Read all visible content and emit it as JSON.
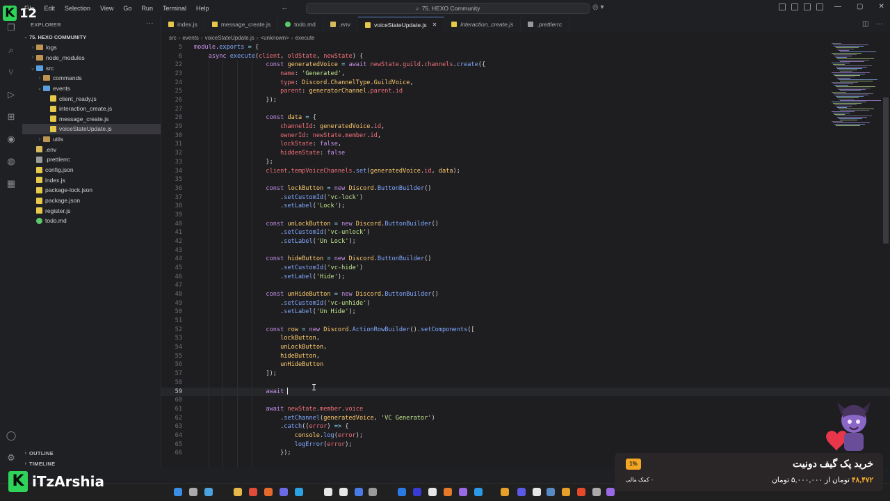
{
  "menu": [
    "File",
    "Edit",
    "Selection",
    "View",
    "Go",
    "Run",
    "Terminal",
    "Help"
  ],
  "command_center": "75. HEXO Community",
  "explorer": {
    "header": "EXPLORER",
    "root": "75. HEXO COMMUNITY",
    "items": [
      {
        "label": "logs",
        "type": "folder",
        "depth": 1,
        "open": false
      },
      {
        "label": "node_modules",
        "type": "folder",
        "depth": 1,
        "open": false
      },
      {
        "label": "src",
        "type": "folder",
        "depth": 1,
        "open": true
      },
      {
        "label": "commands",
        "type": "folder",
        "depth": 2,
        "open": false
      },
      {
        "label": "events",
        "type": "folder",
        "depth": 2,
        "open": true
      },
      {
        "label": "client_ready.js",
        "type": "js",
        "depth": 3
      },
      {
        "label": "interaction_create.js",
        "type": "js",
        "depth": 3
      },
      {
        "label": "message_create.js",
        "type": "js",
        "depth": 3
      },
      {
        "label": "voiceStateUpdate.js",
        "type": "js",
        "depth": 3,
        "selected": true
      },
      {
        "label": "utils",
        "type": "folder",
        "depth": 2,
        "open": false
      },
      {
        "label": ".env",
        "type": "env",
        "depth": 1
      },
      {
        "label": ".prettierrc",
        "type": "config",
        "depth": 1
      },
      {
        "label": "config.json",
        "type": "json",
        "depth": 1
      },
      {
        "label": "index.js",
        "type": "js",
        "depth": 1
      },
      {
        "label": "package-lock.json",
        "type": "json",
        "depth": 1
      },
      {
        "label": "package.json",
        "type": "json",
        "depth": 1
      },
      {
        "label": "register.js",
        "type": "js",
        "depth": 1
      },
      {
        "label": "todo.md",
        "type": "md",
        "depth": 1
      }
    ],
    "outline": "OUTLINE",
    "timeline": "TIMELINE"
  },
  "tabs": [
    {
      "label": "index.js",
      "type": "js"
    },
    {
      "label": "message_create.js",
      "type": "js"
    },
    {
      "label": "todo.md",
      "type": "md"
    },
    {
      "label": ".env",
      "type": "env"
    },
    {
      "label": "voiceStateUpdate.js",
      "type": "js",
      "active": true
    },
    {
      "label": "interaction_create.js",
      "type": "js"
    },
    {
      "label": ".prettierrc",
      "type": "config"
    }
  ],
  "breadcrumb": [
    "src",
    "events",
    "voiceStateUpdate.js",
    "<unknown>",
    "execute"
  ],
  "code_lines": [
    {
      "n": "5",
      "indent": 0,
      "code": [
        [
          "k",
          "module"
        ],
        [
          "t",
          "."
        ],
        [
          "f",
          "exports"
        ],
        [
          "t",
          " "
        ],
        [
          "o",
          "="
        ],
        [
          "t",
          " {"
        ]
      ]
    },
    {
      "n": "6",
      "indent": 1,
      "code": [
        [
          "k",
          "async "
        ],
        [
          "f",
          "execute"
        ],
        [
          "t",
          "("
        ],
        [
          "v",
          "client"
        ],
        [
          "t",
          ", "
        ],
        [
          "v",
          "oldState"
        ],
        [
          "t",
          ", "
        ],
        [
          "v",
          "newState"
        ],
        [
          "t",
          ") {"
        ]
      ]
    },
    {
      "n": "22",
      "indent": 5,
      "code": [
        [
          "k",
          "const "
        ],
        [
          "c",
          "generatedVoice"
        ],
        [
          "t",
          " "
        ],
        [
          "o",
          "="
        ],
        [
          "t",
          " "
        ],
        [
          "k",
          "await "
        ],
        [
          "v",
          "newState"
        ],
        [
          "t",
          "."
        ],
        [
          "v",
          "guild"
        ],
        [
          "t",
          "."
        ],
        [
          "v",
          "channels"
        ],
        [
          "t",
          "."
        ],
        [
          "f",
          "create"
        ],
        [
          "t",
          "({"
        ]
      ]
    },
    {
      "n": "23",
      "indent": 6,
      "code": [
        [
          "v",
          "name"
        ],
        [
          "t",
          ": "
        ],
        [
          "s",
          "'Generated'"
        ],
        [
          "t",
          ","
        ]
      ]
    },
    {
      "n": "24",
      "indent": 6,
      "code": [
        [
          "v",
          "type"
        ],
        [
          "t",
          ": "
        ],
        [
          "c",
          "Discord"
        ],
        [
          "t",
          "."
        ],
        [
          "c",
          "ChannelType"
        ],
        [
          "t",
          "."
        ],
        [
          "c",
          "GuildVoice"
        ],
        [
          "t",
          ","
        ]
      ]
    },
    {
      "n": "25",
      "indent": 6,
      "code": [
        [
          "v",
          "parent"
        ],
        [
          "t",
          ": "
        ],
        [
          "c",
          "generatorChannel"
        ],
        [
          "t",
          "."
        ],
        [
          "v",
          "parent"
        ],
        [
          "t",
          "."
        ],
        [
          "v",
          "id"
        ]
      ]
    },
    {
      "n": "26",
      "indent": 5,
      "code": [
        [
          "t",
          "});"
        ]
      ]
    },
    {
      "n": "27",
      "indent": 5,
      "code": []
    },
    {
      "n": "28",
      "indent": 5,
      "code": [
        [
          "k",
          "const "
        ],
        [
          "c",
          "data"
        ],
        [
          "t",
          " "
        ],
        [
          "o",
          "="
        ],
        [
          "t",
          " {"
        ]
      ]
    },
    {
      "n": "29",
      "indent": 6,
      "code": [
        [
          "v",
          "channelId"
        ],
        [
          "t",
          ": "
        ],
        [
          "c",
          "generatedVoice"
        ],
        [
          "t",
          "."
        ],
        [
          "v",
          "id"
        ],
        [
          "t",
          ","
        ]
      ]
    },
    {
      "n": "30",
      "indent": 6,
      "code": [
        [
          "v",
          "ownerId"
        ],
        [
          "t",
          ": "
        ],
        [
          "v",
          "newState"
        ],
        [
          "t",
          "."
        ],
        [
          "v",
          "member"
        ],
        [
          "t",
          "."
        ],
        [
          "v",
          "id"
        ],
        [
          "t",
          ","
        ]
      ]
    },
    {
      "n": "31",
      "indent": 6,
      "code": [
        [
          "v",
          "lockState"
        ],
        [
          "t",
          ": "
        ],
        [
          "k",
          "false"
        ],
        [
          "t",
          ","
        ]
      ]
    },
    {
      "n": "32",
      "indent": 6,
      "code": [
        [
          "v",
          "hiddenState"
        ],
        [
          "t",
          ": "
        ],
        [
          "k",
          "false"
        ]
      ]
    },
    {
      "n": "33",
      "indent": 5,
      "code": [
        [
          "t",
          "};"
        ]
      ]
    },
    {
      "n": "34",
      "indent": 5,
      "code": [
        [
          "v",
          "client"
        ],
        [
          "t",
          "."
        ],
        [
          "v",
          "tempVoiceChannels"
        ],
        [
          "t",
          "."
        ],
        [
          "f",
          "set"
        ],
        [
          "t",
          "("
        ],
        [
          "c",
          "generatedVoice"
        ],
        [
          "t",
          "."
        ],
        [
          "v",
          "id"
        ],
        [
          "t",
          ", "
        ],
        [
          "c",
          "data"
        ],
        [
          "t",
          ");"
        ]
      ]
    },
    {
      "n": "35",
      "indent": 5,
      "code": []
    },
    {
      "n": "36",
      "indent": 5,
      "code": [
        [
          "k",
          "const "
        ],
        [
          "c",
          "lockButton"
        ],
        [
          "t",
          " "
        ],
        [
          "o",
          "="
        ],
        [
          "t",
          " "
        ],
        [
          "k",
          "new "
        ],
        [
          "c",
          "Discord"
        ],
        [
          "t",
          "."
        ],
        [
          "f",
          "ButtonBuilder"
        ],
        [
          "t",
          "()"
        ]
      ]
    },
    {
      "n": "37",
      "indent": 6,
      "code": [
        [
          "t",
          "."
        ],
        [
          "f",
          "setCustomId"
        ],
        [
          "t",
          "("
        ],
        [
          "s",
          "'vc-lock'"
        ],
        [
          "t",
          ")"
        ]
      ]
    },
    {
      "n": "38",
      "indent": 6,
      "code": [
        [
          "t",
          "."
        ],
        [
          "f",
          "setLabel"
        ],
        [
          "t",
          "("
        ],
        [
          "s",
          "'Lock'"
        ],
        [
          "t",
          ");"
        ]
      ]
    },
    {
      "n": "39",
      "indent": 5,
      "code": []
    },
    {
      "n": "40",
      "indent": 5,
      "code": [
        [
          "k",
          "const "
        ],
        [
          "c",
          "unLockButton"
        ],
        [
          "t",
          " "
        ],
        [
          "o",
          "="
        ],
        [
          "t",
          " "
        ],
        [
          "k",
          "new "
        ],
        [
          "c",
          "Discord"
        ],
        [
          "t",
          "."
        ],
        [
          "f",
          "ButtonBuilder"
        ],
        [
          "t",
          "()"
        ]
      ]
    },
    {
      "n": "41",
      "indent": 6,
      "code": [
        [
          "t",
          "."
        ],
        [
          "f",
          "setCustomId"
        ],
        [
          "t",
          "("
        ],
        [
          "s",
          "'vc-unlock'"
        ],
        [
          "t",
          ")"
        ]
      ]
    },
    {
      "n": "42",
      "indent": 6,
      "code": [
        [
          "t",
          "."
        ],
        [
          "f",
          "setLabel"
        ],
        [
          "t",
          "("
        ],
        [
          "s",
          "'Un Lock'"
        ],
        [
          "t",
          ");"
        ]
      ]
    },
    {
      "n": "43",
      "indent": 5,
      "code": []
    },
    {
      "n": "44",
      "indent": 5,
      "code": [
        [
          "k",
          "const "
        ],
        [
          "c",
          "hideButton"
        ],
        [
          "t",
          " "
        ],
        [
          "o",
          "="
        ],
        [
          "t",
          " "
        ],
        [
          "k",
          "new "
        ],
        [
          "c",
          "Discord"
        ],
        [
          "t",
          "."
        ],
        [
          "f",
          "ButtonBuilder"
        ],
        [
          "t",
          "()"
        ]
      ]
    },
    {
      "n": "45",
      "indent": 6,
      "code": [
        [
          "t",
          "."
        ],
        [
          "f",
          "setCustomId"
        ],
        [
          "t",
          "("
        ],
        [
          "s",
          "'vc-hide'"
        ],
        [
          "t",
          ")"
        ]
      ]
    },
    {
      "n": "46",
      "indent": 6,
      "code": [
        [
          "t",
          "."
        ],
        [
          "f",
          "setLabel"
        ],
        [
          "t",
          "("
        ],
        [
          "s",
          "'Hide'"
        ],
        [
          "t",
          ");"
        ]
      ]
    },
    {
      "n": "47",
      "indent": 5,
      "code": []
    },
    {
      "n": "48",
      "indent": 5,
      "code": [
        [
          "k",
          "const "
        ],
        [
          "c",
          "unHideButton"
        ],
        [
          "t",
          " "
        ],
        [
          "o",
          "="
        ],
        [
          "t",
          " "
        ],
        [
          "k",
          "new "
        ],
        [
          "c",
          "Discord"
        ],
        [
          "t",
          "."
        ],
        [
          "f",
          "ButtonBuilder"
        ],
        [
          "t",
          "()"
        ]
      ]
    },
    {
      "n": "49",
      "indent": 6,
      "code": [
        [
          "t",
          "."
        ],
        [
          "f",
          "setCustomId"
        ],
        [
          "t",
          "("
        ],
        [
          "s",
          "'vc-unhide'"
        ],
        [
          "t",
          ")"
        ]
      ]
    },
    {
      "n": "50",
      "indent": 6,
      "code": [
        [
          "t",
          "."
        ],
        [
          "f",
          "setLabel"
        ],
        [
          "t",
          "("
        ],
        [
          "s",
          "'Un Hide'"
        ],
        [
          "t",
          ");"
        ]
      ]
    },
    {
      "n": "51",
      "indent": 5,
      "code": []
    },
    {
      "n": "52",
      "indent": 5,
      "code": [
        [
          "k",
          "const "
        ],
        [
          "c",
          "row"
        ],
        [
          "t",
          " "
        ],
        [
          "o",
          "="
        ],
        [
          "t",
          " "
        ],
        [
          "k",
          "new "
        ],
        [
          "c",
          "Discord"
        ],
        [
          "t",
          "."
        ],
        [
          "f",
          "ActionRowBuilder"
        ],
        [
          "t",
          "()."
        ],
        [
          "f",
          "setComponents"
        ],
        [
          "t",
          "(["
        ]
      ]
    },
    {
      "n": "53",
      "indent": 6,
      "code": [
        [
          "c",
          "lockButton"
        ],
        [
          "t",
          ","
        ]
      ]
    },
    {
      "n": "54",
      "indent": 6,
      "code": [
        [
          "c",
          "unLockButton"
        ],
        [
          "t",
          ","
        ]
      ]
    },
    {
      "n": "55",
      "indent": 6,
      "code": [
        [
          "c",
          "hideButton"
        ],
        [
          "t",
          ","
        ]
      ]
    },
    {
      "n": "56",
      "indent": 6,
      "code": [
        [
          "c",
          "unHideButton"
        ]
      ]
    },
    {
      "n": "57",
      "indent": 5,
      "code": [
        [
          "t",
          "]);"
        ]
      ]
    },
    {
      "n": "58",
      "indent": 5,
      "code": []
    },
    {
      "n": "59",
      "indent": 5,
      "current": true,
      "code": [
        [
          "k",
          "await "
        ]
      ]
    },
    {
      "n": "60",
      "indent": 5,
      "code": []
    },
    {
      "n": "61",
      "indent": 5,
      "code": [
        [
          "k",
          "await "
        ],
        [
          "v",
          "newState"
        ],
        [
          "t",
          "."
        ],
        [
          "v",
          "member"
        ],
        [
          "t",
          "."
        ],
        [
          "v",
          "voice"
        ]
      ]
    },
    {
      "n": "62",
      "indent": 6,
      "code": [
        [
          "t",
          "."
        ],
        [
          "f",
          "setChannel"
        ],
        [
          "t",
          "("
        ],
        [
          "c",
          "generatedVoice"
        ],
        [
          "t",
          ", "
        ],
        [
          "s",
          "'VC Generator'"
        ],
        [
          "t",
          ")"
        ]
      ]
    },
    {
      "n": "63",
      "indent": 6,
      "code": [
        [
          "t",
          "."
        ],
        [
          "f",
          "catch"
        ],
        [
          "t",
          "(("
        ],
        [
          "v",
          "error"
        ],
        [
          "t",
          ") "
        ],
        [
          "o",
          "=>"
        ],
        [
          "t",
          " {"
        ]
      ]
    },
    {
      "n": "64",
      "indent": 7,
      "code": [
        [
          "c",
          "console"
        ],
        [
          "t",
          "."
        ],
        [
          "f",
          "log"
        ],
        [
          "t",
          "("
        ],
        [
          "v",
          "error"
        ],
        [
          "t",
          ");"
        ]
      ]
    },
    {
      "n": "65",
      "indent": 7,
      "code": [
        [
          "f",
          "logError"
        ],
        [
          "t",
          "("
        ],
        [
          "v",
          "error"
        ],
        [
          "t",
          ");"
        ]
      ]
    },
    {
      "n": "66",
      "indent": 6,
      "code": [
        [
          "t",
          "});"
        ]
      ]
    }
  ],
  "promo": {
    "title": "خرید پک گیف دونیت",
    "price_new": "۴۸,۴۷۲",
    "price_text_mid": "تومان از",
    "price_old": "۵,۰۰۰,۰۰۰ تومان",
    "percent": "1%",
    "help": "۰ کمک مالی"
  },
  "logo_top": {
    "letter": "K",
    "number": "12"
  },
  "brand": {
    "letter": "K",
    "name": "iTzArshia"
  },
  "icon_colors": {
    "js": "#e6c84a",
    "json": "#e6c84a",
    "md": "#5bc96a",
    "env": "#d7ba5b",
    "config": "#9a9a9a",
    "folder": "#c09553",
    "folder_open": "#5aa0e0"
  }
}
